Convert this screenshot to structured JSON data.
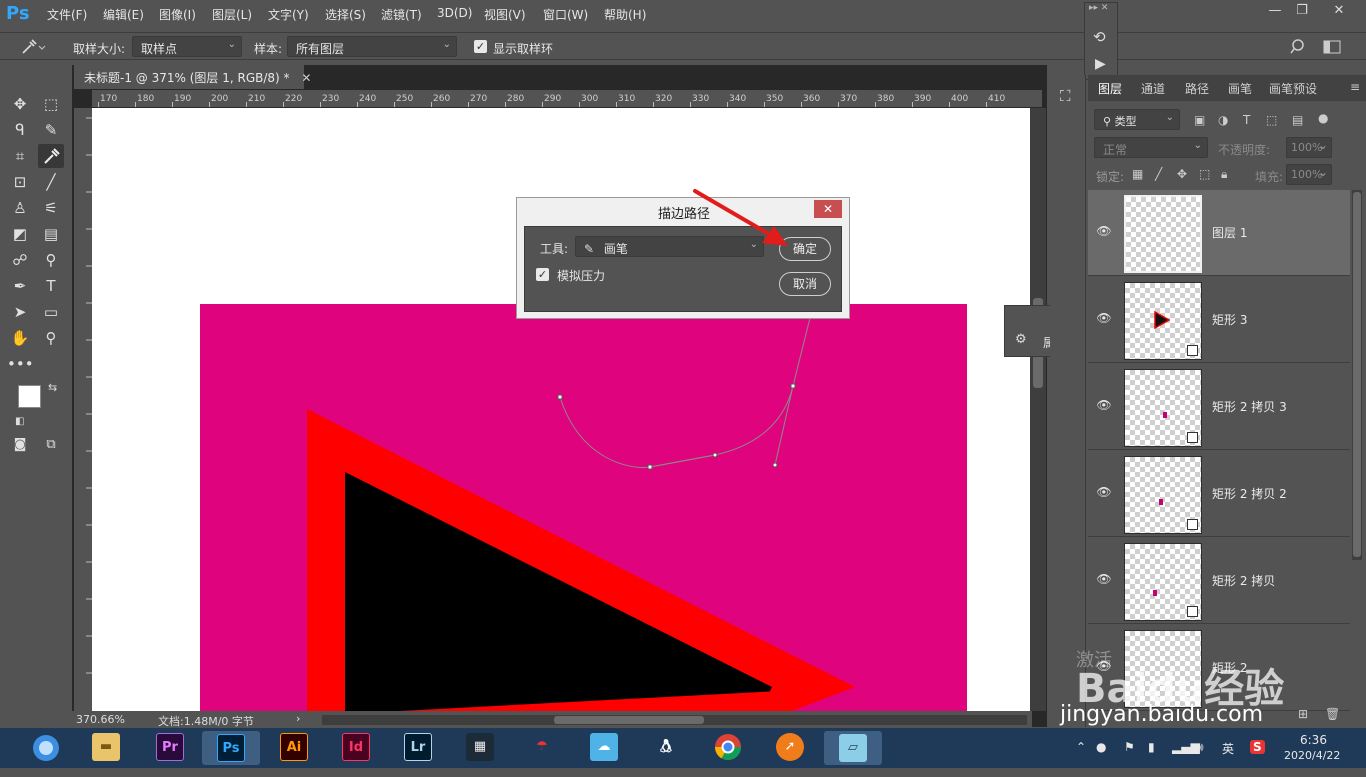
{
  "app": {
    "logo": "Ps"
  },
  "menu": [
    "文件(F)",
    "编辑(E)",
    "图像(I)",
    "图层(L)",
    "文字(Y)",
    "选择(S)",
    "滤镜(T)",
    "3D(D)",
    "视图(V)",
    "窗口(W)",
    "帮助(H)"
  ],
  "window_controls": {
    "minimize": "—",
    "restore": "❐",
    "close": "✕"
  },
  "options": {
    "sample_size_label": "取样大小:",
    "sample_size_value": "取样点",
    "sample_label": "样本:",
    "sample_value": "所有图层",
    "show_ring_label": "显示取样环"
  },
  "document": {
    "tab_title": "未标题-1 @ 371% (图层 1, RGB/8) *",
    "ruler_h": [
      "170",
      "180",
      "190",
      "200",
      "210",
      "220",
      "230",
      "240",
      "250",
      "260",
      "270",
      "280",
      "290",
      "300",
      "310",
      "320",
      "330",
      "340",
      "350",
      "360",
      "370",
      "380",
      "390",
      "400",
      "410"
    ],
    "zoom": "370.66%",
    "doc_info": "文档:1.48M/0 字节"
  },
  "dialog": {
    "title": "描边路径",
    "tool_label": "工具:",
    "tool_value": "画笔",
    "simulate_pressure": "模拟压力",
    "ok": "确定",
    "cancel": "取消"
  },
  "props_panel": {
    "label": "属性"
  },
  "layers_panel": {
    "tabs": [
      "图层",
      "通道",
      "路径",
      "画笔",
      "画笔预设"
    ],
    "filter_label": "类型",
    "blend_mode": "正常",
    "opacity_label": "不透明度:",
    "opacity_value": "100%",
    "lock_label": "锁定:",
    "fill_label": "填充:",
    "fill_value": "100%",
    "layers": [
      {
        "name": "图层 1"
      },
      {
        "name": "矩形 3"
      },
      {
        "name": "矩形 2 拷贝 3"
      },
      {
        "name": "矩形 2 拷贝 2"
      },
      {
        "name": "矩形 2 拷贝"
      },
      {
        "name": "矩形 2"
      }
    ]
  },
  "taskbar": {
    "apps": [
      "Pr",
      "Ps",
      "Ai",
      "Id",
      "Lr"
    ],
    "ime": "英",
    "time": "6:36",
    "date": "2020/4/22"
  },
  "watermark": {
    "text1": "激活",
    "brand": "Baidu经验",
    "url": "jingyan.baidu.com"
  },
  "colors": {
    "canvas_magenta": "#e0037e",
    "triangle_red": "#ff0000",
    "accent_blue": "#31a8ff"
  }
}
